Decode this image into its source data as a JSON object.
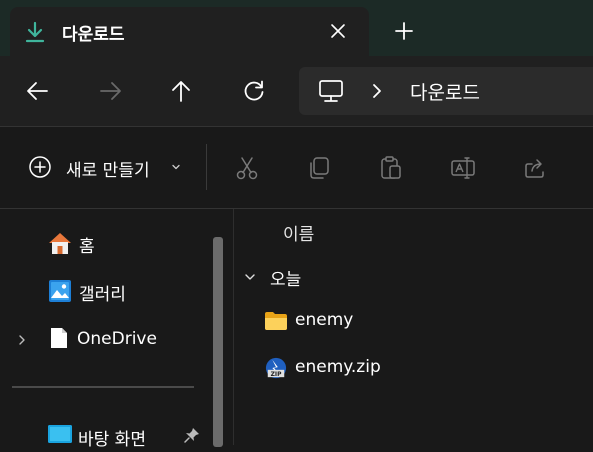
{
  "tab": {
    "title": "다운로드",
    "close_icon": "close-icon",
    "new_tab_icon": "plus-icon"
  },
  "nav": {
    "back": "back-arrow-icon",
    "forward": "forward-arrow-icon",
    "up": "up-arrow-icon",
    "refresh": "refresh-icon"
  },
  "address": {
    "root_icon": "pc-icon",
    "path": [
      "다운로드"
    ]
  },
  "toolbar": {
    "new_label": "새로 만들기",
    "actions": [
      "cut-icon",
      "copy-icon",
      "paste-icon",
      "rename-icon",
      "share-icon"
    ]
  },
  "sidebar": {
    "items": [
      {
        "label": "홈",
        "icon": "home-icon"
      },
      {
        "label": "갤러리",
        "icon": "gallery-icon"
      },
      {
        "label": "OneDrive",
        "icon": "onedrive-icon"
      },
      {
        "label": "바탕 화면",
        "icon": "desktop-icon",
        "pinned": true
      }
    ]
  },
  "content": {
    "column_header": "이름",
    "group": "오늘",
    "files": [
      {
        "name": "enemy",
        "type": "folder"
      },
      {
        "name": "enemy.zip",
        "type": "zip"
      }
    ]
  },
  "colors": {
    "accent": "#3fb59c",
    "folder": "#f4c542",
    "background": "#191919"
  }
}
